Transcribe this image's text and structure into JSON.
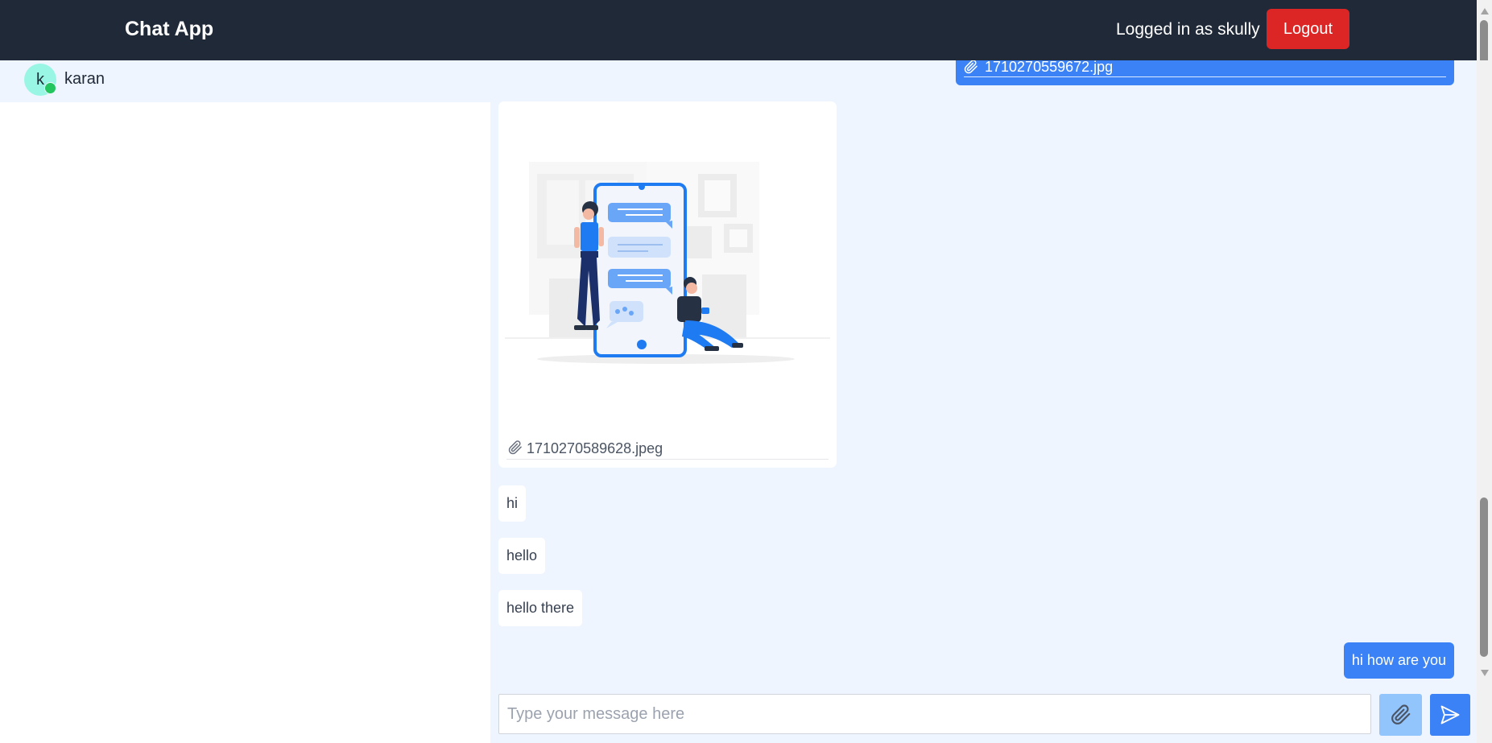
{
  "navbar": {
    "brand": "Chat App",
    "logged_in_text": "Logged in as skully",
    "logout_label": "Logout"
  },
  "contact": {
    "avatar_initial": "k",
    "name": "karan",
    "status": "online"
  },
  "messages": {
    "sent_file": {
      "filename": "1710270559672.jpg",
      "icon": "paperclip-icon"
    },
    "received_image": {
      "filename": "1710270589628.jpeg",
      "icon": "paperclip-icon",
      "image_semantic": "chat-illustration-image"
    },
    "received_texts": [
      "hi",
      "hello",
      "hello there"
    ],
    "sent_text": "hi how are you"
  },
  "composer": {
    "placeholder": "Type your message here",
    "value": "",
    "attach_icon": "paperclip-icon",
    "send_icon": "send-icon"
  },
  "colors": {
    "navbar_bg": "#1f2937",
    "logout_bg": "#dc2626",
    "sent_bubble": "#3b82f6",
    "attach_button": "#93c5fd",
    "chat_bg": "#eef5ff",
    "online": "#22c55e",
    "avatar_bg": "#99f6e4"
  }
}
